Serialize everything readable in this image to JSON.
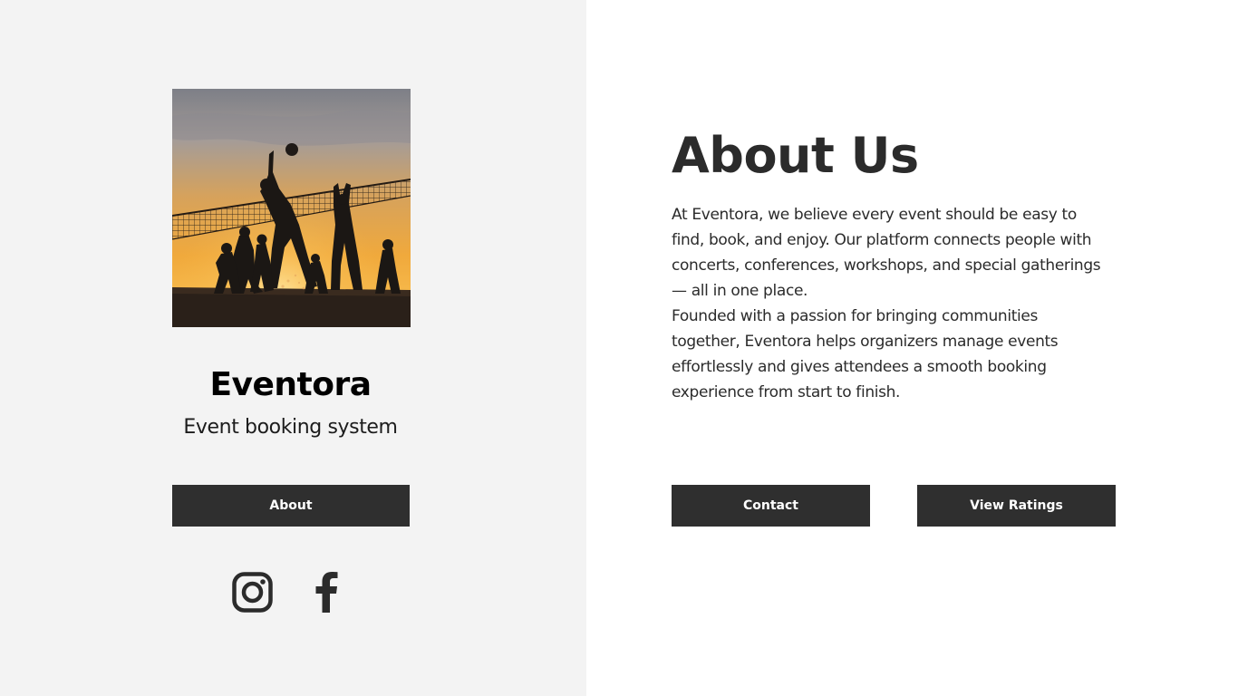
{
  "brand": {
    "name": "Eventora",
    "tagline": "Event booking system"
  },
  "hero_image": {
    "description_icon": "volleyball-sunset-photo"
  },
  "left_buttons": {
    "about_label": "About"
  },
  "social": {
    "instagram_icon": "instagram-icon",
    "facebook_icon": "facebook-icon"
  },
  "about": {
    "title": "About Us",
    "paragraph_1": "At Eventora, we believe every event should be easy to find, book, and enjoy. Our platform connects people with concerts, conferences, workshops, and special gatherings — all in one place.",
    "paragraph_2": "Founded with a passion for bringing communities together, Eventora helps organizers manage events effortlessly and gives attendees a smooth booking experience from start to finish."
  },
  "right_buttons": {
    "contact_label": "Contact",
    "ratings_label": "View Ratings"
  },
  "colors": {
    "left_panel_bg": "#f3f3f3",
    "right_panel_bg": "#ffffff",
    "button_bg": "#2f2f2f",
    "button_text": "#ffffff",
    "text_dark": "#2b2b2b"
  }
}
